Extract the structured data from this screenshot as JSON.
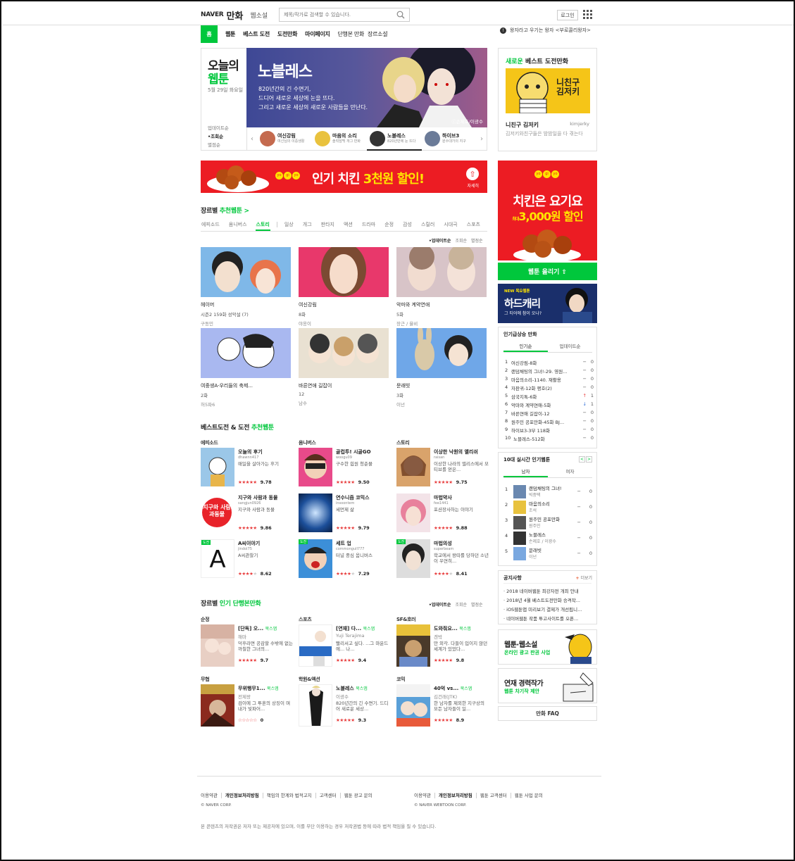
{
  "header": {
    "logo_naver": "NAVER",
    "logo_service": "만화",
    "websoseol": "웹소설",
    "search_placeholder": "제목/작가로 검색할 수 있습니다.",
    "login": "로그인"
  },
  "nav": {
    "home": "홈",
    "items": [
      "웹툰",
      "베스트 도전",
      "도전만화",
      "마이페이지",
      "단행본 만화",
      "장르소설"
    ],
    "notice": "왕자라고 우기는 왕자 <부로콜리왕자>"
  },
  "today": {
    "title1": "오늘의",
    "title2": "웹툰",
    "date": "5월 29일 화요일",
    "sorts": [
      "업데이트순",
      "•조회순",
      "별점순"
    ]
  },
  "main_banner": {
    "title": "노블레스",
    "desc": [
      "820년간의 긴 수면기,",
      "드디어 새로운 세상에 눈을 뜨다.",
      "그리고 새로운 세상의 새로운 사람들을 만난다."
    ],
    "copyright": "ⓒ손제호/이광수"
  },
  "banner_thumbs": [
    {
      "name": "여신강림",
      "sub": "여신님의 이중생활"
    },
    {
      "name": "마음의 소리",
      "sub": "솔직담백 개그 만화"
    },
    {
      "name": "노블레스",
      "sub": "820년만에 눈 뜨다"
    },
    {
      "name": "하이브3",
      "sub": "원수대가의 지구"
    }
  ],
  "new_challenge": {
    "label_green": "새로운",
    "label": "베스트 도전만화",
    "art_text": "니친구 김저키",
    "name": "니친구 김저키",
    "author": "kimjerky",
    "desc": "김저키와친구들은 밤밤일을 다 겪는다"
  },
  "ad_main": {
    "logo": [
      "yo",
      "gi",
      "yo"
    ],
    "text_a": "인기 치킨",
    "text_b": "3천원 할인!",
    "more": "자세히"
  },
  "ad_side": {
    "logo": [
      "yo",
      "gi",
      "yo"
    ],
    "line1": "치킨은 요기요",
    "line2_small": "최대",
    "line2": "3,000원 할인"
  },
  "upload_button": "웹툰 올리기 ⇧",
  "hardcarry": {
    "badge": "NEW 목요웹툰",
    "title": "하드캐리",
    "sub": "그 티어에 참이 오나?"
  },
  "genre_recommend": {
    "title": "장르별",
    "title_green": "추천웹툰 >",
    "tabs": [
      "에피소드",
      "옴니버스",
      "스토리",
      "일상",
      "개그",
      "판타지",
      "액션",
      "드라마",
      "순정",
      "감성",
      "스릴러",
      "시대극",
      "스포츠"
    ],
    "sorts": [
      "•업데이트순",
      "조회순",
      "별점순"
    ],
    "cards": [
      {
        "name": "헤이머",
        "ep": "시즌2 159화 성악설 (7)",
        "author": "구동민"
      },
      {
        "name": "여신강림",
        "ep": "8화",
        "author": "야옹이"
      },
      {
        "name": "악마와 계약연애",
        "ep": "5화",
        "author": "장근 / 율비"
      },
      {
        "name": "여중생A-우리들의 축제...",
        "ep": "2화",
        "author": "허5파6"
      },
      {
        "name": "바른연애 길잡이",
        "ep": "12",
        "author": "남수"
      },
      {
        "name": "문래빗",
        "ep": "3화",
        "author": "이넌"
      }
    ]
  },
  "best_challenge": {
    "title": "베스트도전 & 도전",
    "title_green": "추천웹툰",
    "columns": [
      {
        "genre": "에피소드",
        "items": [
          {
            "name": "오늘의 후기",
            "author": "dhawnn417",
            "desc": "매일을 살아가는 후기",
            "stars": "★★★★★",
            "score": "9.78"
          },
          {
            "name": "지구와 사람과 동물",
            "author": "sangjun0926",
            "desc": "지구와 사람과 동물",
            "stars": "★★★★★",
            "score": "9.86",
            "art": "지구와 사람과동물"
          },
          {
            "name": "A씨이야기",
            "author": "jindol75",
            "desc": "A씨관찰기",
            "stars": "★★★★",
            "score": "8.62",
            "badge": "도전",
            "art": "A"
          }
        ]
      },
      {
        "genre": "옴니버스",
        "items": [
          {
            "name": "골컵투! 시골GO",
            "author": "woogu09",
            "desc": "구수한 힙원 청춘물",
            "stars": "★★★★★",
            "score": "9.50"
          },
          {
            "name": "연수니즘 코믹스",
            "author": "insoontem",
            "desc": "세먼제 삶",
            "stars": "★★★★★",
            "score": "9.79"
          },
          {
            "name": "세트 업",
            "author": "commongull777",
            "desc": "터널 중심 옴니버스",
            "stars": "★★★★",
            "score": "7.29",
            "badge": "도전"
          }
        ]
      },
      {
        "genre": "스토리",
        "items": [
          {
            "name": "이상한 낙원의 앨리쉬",
            "author": "raisan",
            "desc": "이상한 나라의 앨리스에서 모티브를 얻은...",
            "stars": "★★★★★",
            "score": "9.75"
          },
          {
            "name": "마법약사",
            "author": "fee1441",
            "desc": "포션장사하는 이야기",
            "stars": "★★★★★",
            "score": "9.88"
          },
          {
            "name": "마법의성",
            "author": "superbeam",
            "desc": "학교에서 왕따를 당하던 소년이 우연히...",
            "stars": "★★★★",
            "score": "8.41",
            "badge": "도전"
          }
        ]
      }
    ]
  },
  "books": {
    "title": "장르별",
    "title_green": "인기 단행본만화",
    "sorts": [
      "•업데이트순",
      "조회순",
      "별점순"
    ],
    "groups": [
      {
        "genre": "순정",
        "name": "[단독] 오...",
        "tag": "북스앱",
        "author": "해마",
        "desc": "덕후라면 공감할 수밖에 없는 까칠한 그녀의...",
        "stars": "★★★★★",
        "score": "9.7"
      },
      {
        "genre": "스포츠",
        "name": "[연재] 다...",
        "tag": "북스앱",
        "author": "Yuji Terajima",
        "desc": "빨리서고 싶다. ...그 마운드에... 나...",
        "stars": "★★★★★",
        "score": "9.4"
      },
      {
        "genre": "SF&호러",
        "name": "도와줘요...",
        "tag": "북스앱",
        "author": "겐박",
        "desc": "만 외각. 다들이 입이지 않던 세계가 있었다...",
        "stars": "★★★★★",
        "score": "9.8"
      },
      {
        "genre": "무협",
        "name": "무위행무1...",
        "tag": "북스앱",
        "author": "전제왕",
        "desc": "검이에 그 투혼의 상징이 며 내가 빛파어...",
        "stars": "☆☆☆☆☆",
        "score": "0"
      },
      {
        "genre": "학원&액션",
        "name": "노블레스",
        "tag": "북스앱",
        "author": "이광수",
        "desc": "820년간의 긴 수면기. 드디어 새로운 세상...",
        "stars": "★★★★★",
        "score": "9.3"
      },
      {
        "genre": "코믹",
        "name": "40억 vs...",
        "tag": "북스앱",
        "author": "김건래(JTK)",
        "desc": "한 남자를 제외한 지구상의 모든 남자들이 일...",
        "stars": "★★★★",
        "score": "8.9"
      }
    ]
  },
  "ranking": {
    "title": "인기급상승 만화",
    "tabs": [
      "인기순",
      "업데이트순"
    ],
    "items": [
      {
        "rank": "1",
        "title": "여신강림-8화",
        "change": "−",
        "val": "0"
      },
      {
        "rank": "2",
        "title": "랜덤채팅의 그녀!-29. 영원...",
        "change": "−",
        "val": "0"
      },
      {
        "rank": "3",
        "title": "마음의소리-1140. 재활용",
        "change": "−",
        "val": "0"
      },
      {
        "rank": "4",
        "title": "자판귀-12화 평호(2)",
        "change": "−",
        "val": "0"
      },
      {
        "rank": "5",
        "title": "삼국지톡-6화",
        "change": "↑",
        "val": "1"
      },
      {
        "rank": "6",
        "title": "악마와 계약연애-5화",
        "change": "↓",
        "val": "1"
      },
      {
        "rank": "7",
        "title": "바른연애 길잡이-12",
        "change": "−",
        "val": "0"
      },
      {
        "rank": "8",
        "title": "원주민 공포만화-45화 BJ...",
        "change": "−",
        "val": "0"
      },
      {
        "rank": "9",
        "title": "하이브3-3부 118화",
        "change": "−",
        "val": "0"
      },
      {
        "rank": "10",
        "title": "노블레스-512화",
        "change": "−",
        "val": "0"
      }
    ]
  },
  "live": {
    "title": "10대 실시간 인기웹툰",
    "nav": [
      "<",
      ">"
    ],
    "tabs": [
      "남자",
      "여자"
    ],
    "items": [
      {
        "rank": "1",
        "title": "랜덤채팅의 그녀!",
        "author": "빅중택",
        "change": "−",
        "val": "0"
      },
      {
        "rank": "2",
        "title": "마음의소리",
        "author": "조석",
        "change": "−",
        "val": "0"
      },
      {
        "rank": "3",
        "title": "원주민 공포만화",
        "author": "원주민",
        "change": "−",
        "val": "0"
      },
      {
        "rank": "4",
        "title": "노블레스",
        "author": "손제호 / 이광수",
        "change": "−",
        "val": "0"
      },
      {
        "rank": "5",
        "title": "문래빗",
        "author": "이넌",
        "change": "−",
        "val": "0"
      }
    ]
  },
  "notices": {
    "title": "공지사항",
    "more": "더보기",
    "items": [
      "· 2018 네이버웹툰 최강자전 개최 안내",
      "· 2018년 4월 베스트도전만화 승격작...",
      "· iOS웹툰앱 미리보기 결제가 개선됩니...",
      "· 네이버웹툰 작품 투고사이트를 오픈..."
    ]
  },
  "ads_small": [
    {
      "t1": "웹툰·웹소설",
      "t2": "온라인 광고 판권 사업"
    },
    {
      "t1": "연재 경력작가",
      "t2": "웹툰 차기작 제안"
    }
  ],
  "faq": "만화 FAQ",
  "footer": {
    "links_left": [
      "이용약관",
      "개인정보처리방침",
      "책임의 한계와 법적고지",
      "고객센터",
      "웹툰 광고 문의"
    ],
    "corp_left": "© NAVER CORP.",
    "links_right": [
      "이용약관",
      "개인정보처리방침",
      "웹툰 고객센터",
      "웹툰 사업 문의"
    ],
    "corp_right": "© NAVER WEBTOON CORP.",
    "legal": "본 콘텐츠의 저작권은 저자 또는 제공처에 있으며, 이를 무단 이용하는 경우 저작권법 등에 따라 법적 책임을 질 수 있습니다."
  },
  "colors": {
    "brand_green": "#00c73c",
    "ad_red": "#ec1c23",
    "star_red": "#e83b3b"
  }
}
